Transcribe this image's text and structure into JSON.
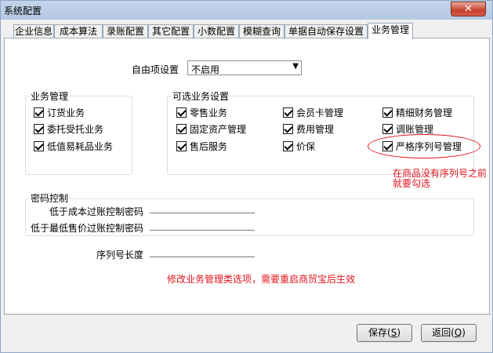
{
  "window": {
    "title": "系统配置",
    "close": "✕"
  },
  "tabs": [
    {
      "label": "企业信息"
    },
    {
      "label": "成本算法"
    },
    {
      "label": "录账配置"
    },
    {
      "label": "其它配置"
    },
    {
      "label": "小数配置"
    },
    {
      "label": "模糊查询"
    },
    {
      "label": "单据自动保存设置"
    },
    {
      "label": "业务管理",
      "active": true
    }
  ],
  "custom_setting": {
    "label": "自由项设置",
    "value": "不启用",
    "arrow": "▼"
  },
  "business_group": {
    "title": "业务管理",
    "items": [
      {
        "label": "订货业务",
        "checked": true
      },
      {
        "label": "委托受托业务",
        "checked": true
      },
      {
        "label": "低值易耗品业务",
        "checked": true
      }
    ]
  },
  "optional_group": {
    "title": "可选业务设置",
    "items": [
      {
        "label": "零售业务",
        "checked": true
      },
      {
        "label": "会员卡管理",
        "checked": true
      },
      {
        "label": "精细财务管理",
        "checked": true
      },
      {
        "label": "固定资产管理",
        "checked": true
      },
      {
        "label": "费用管理",
        "checked": true
      },
      {
        "label": "调账管理",
        "checked": true
      },
      {
        "label": "售后服务",
        "checked": true
      },
      {
        "label": "价保",
        "checked": true
      },
      {
        "label": "严格序列号管理",
        "checked": true
      }
    ]
  },
  "annotation": {
    "line1": "在商品没有序列号之前",
    "line2": "就要勾选",
    "color": "#e0141e"
  },
  "password_group": {
    "title": "密码控制",
    "cost_password_label": "低于成本过账控制密码",
    "min_price_password_label": "低于最低售价过账控制密码"
  },
  "serial_length": {
    "label": "序列号长度"
  },
  "notice": "修改业务管理类选项，需要重启商贸宝后生效",
  "buttons": {
    "save": "保存",
    "save_key": "S",
    "back": "返回",
    "back_key": "Q"
  }
}
